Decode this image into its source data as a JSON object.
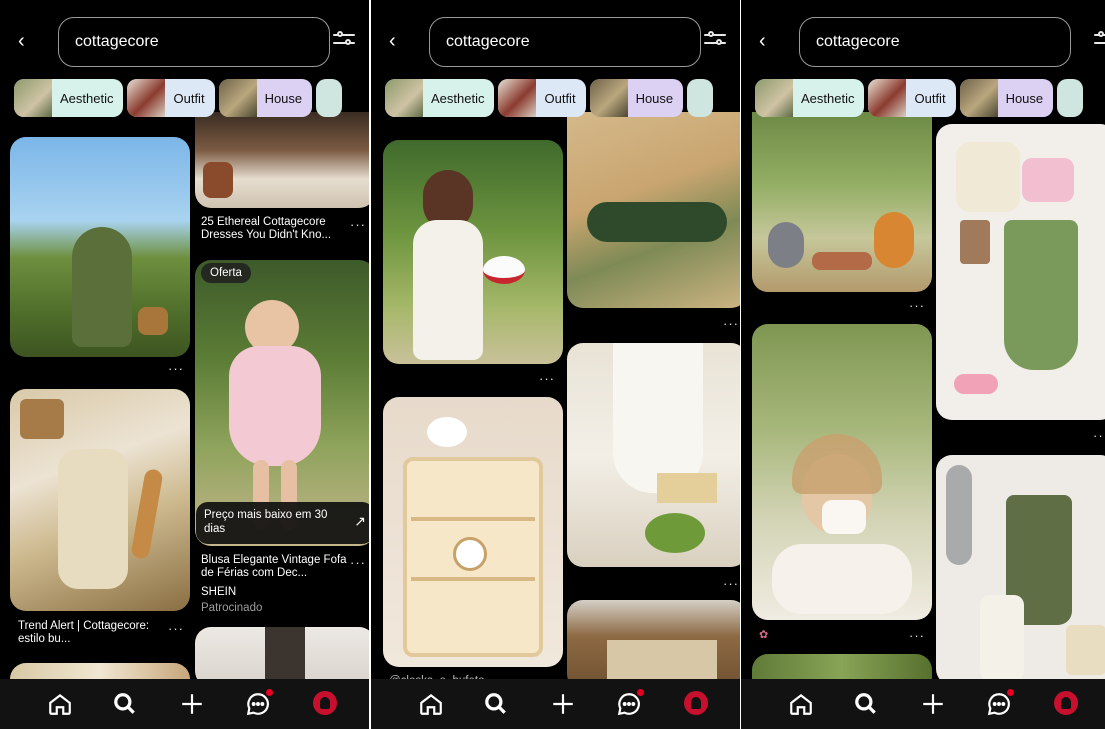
{
  "search": {
    "query": "cottagecore"
  },
  "chips": [
    {
      "label": "Aesthetic"
    },
    {
      "label": "Outfit"
    },
    {
      "label": "House"
    }
  ],
  "screen1": {
    "pin_dresses_title": "25 Ethereal Cottagecore Dresses You Didn't Kno...",
    "offer_badge": "Oferta",
    "promo_text": "Preço mais baixo em 30 dias",
    "product_title": "Blusa Elegante Vintage Fofa de Férias com Dec...",
    "product_brand": "SHEIN",
    "sponsored": "Patrocinado",
    "trend_title": "Trend Alert | Cottagecore: estilo bu..."
  },
  "screen2": {
    "creator_partial": "@closka_e_bufeto"
  },
  "more_glyph": "···",
  "arrow_glyph": "↗",
  "nav": {
    "home": "home-icon",
    "search": "search-icon",
    "create": "plus-icon",
    "messages": "chat-icon",
    "profile": "avatar"
  },
  "colors": {
    "background": "#000000",
    "accent": "#e60023",
    "chip_aesthetic": "#d7f2ea",
    "chip_outfit": "#dde8f7",
    "chip_house": "#ddd1f3"
  }
}
